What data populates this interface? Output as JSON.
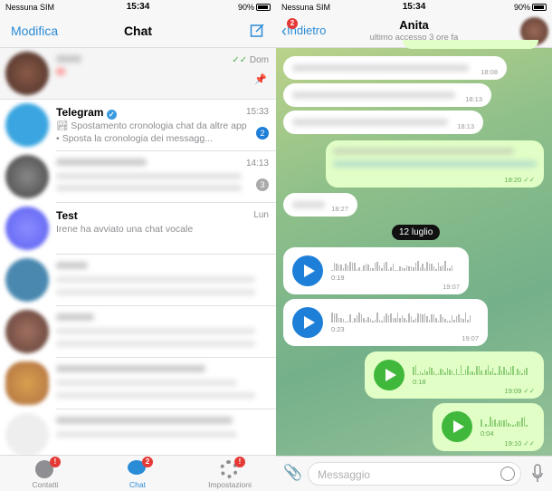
{
  "status": {
    "carrier": "Nessuna SIM",
    "time": "15:34",
    "battery": "90%",
    "battery_level": 0.9
  },
  "chat_list": {
    "edit_label": "Modifica",
    "title": "Chat",
    "compose_icon": "compose-icon",
    "rows": [
      {
        "time": "Dom",
        "pinned": true,
        "read": true
      },
      {
        "name": "Telegram",
        "verified": true,
        "time": "15:33",
        "preview": "🏞 Spostamento cronologia chat da altre app • Sposta la cronologia dei messagg...",
        "unread": "2"
      },
      {
        "time": "14:13",
        "unread": "3",
        "muted": true
      },
      {
        "name": "Test",
        "time": "Lun",
        "preview": "Irene ha avviato una chat vocale"
      },
      {},
      {},
      {},
      {}
    ],
    "tabs": [
      {
        "label": "Contatti",
        "badge": "!"
      },
      {
        "label": "Chat",
        "badge": "2",
        "active": true
      },
      {
        "label": "Impostazioni",
        "badge": "!"
      }
    ]
  },
  "conversation": {
    "back_label": "Indietro",
    "back_badge": "2",
    "contact": "Anita",
    "subtitle": "ultimo accesso 3 ore fa",
    "messages": [
      {
        "dir": "in",
        "time": "18:08"
      },
      {
        "dir": "in",
        "time": "18:13"
      },
      {
        "dir": "in",
        "time": "18:13"
      },
      {
        "dir": "out",
        "time": "18:20"
      },
      {
        "dir": "in",
        "time": "18:27"
      }
    ],
    "date_separator": "12 luglio",
    "voice": [
      {
        "dir": "in",
        "duration": "0:19",
        "time": "19:07"
      },
      {
        "dir": "in",
        "duration": "0:23",
        "time": "19:07"
      },
      {
        "dir": "out",
        "duration": "0:18",
        "time": "19:09"
      },
      {
        "dir": "out",
        "duration": "0:04",
        "time": "19:10"
      }
    ],
    "input_placeholder": "Messaggio"
  },
  "colors": {
    "accent": "#2a8bd6",
    "badge_red": "#e53935",
    "out_bubble": "#e1fec6",
    "voice_in": "#1e7fd8",
    "voice_out": "#3fb83b"
  }
}
